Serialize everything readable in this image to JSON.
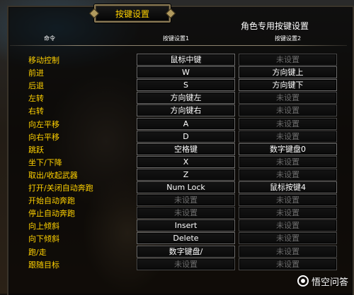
{
  "dialog": {
    "title": "按键设置",
    "character_specific_label": "角色专用按键设置",
    "columns": {
      "command": "命令",
      "key1": "按键设置1",
      "key2": "按键设置2"
    }
  },
  "bindings": [
    {
      "command": "移动控制",
      "key1": "鼠标中键",
      "key2": "未设置",
      "key1_set": true,
      "key2_set": false
    },
    {
      "command": "前进",
      "key1": "W",
      "key2": "方向键上",
      "key1_set": true,
      "key2_set": true
    },
    {
      "command": "后退",
      "key1": "S",
      "key2": "方向键下",
      "key1_set": true,
      "key2_set": true
    },
    {
      "command": "左转",
      "key1": "方向键左",
      "key2": "未设置",
      "key1_set": true,
      "key2_set": false
    },
    {
      "command": "右转",
      "key1": "方向键右",
      "key2": "未设置",
      "key1_set": true,
      "key2_set": false
    },
    {
      "command": "向左平移",
      "key1": "A",
      "key2": "未设置",
      "key1_set": true,
      "key2_set": false
    },
    {
      "command": "向右平移",
      "key1": "D",
      "key2": "未设置",
      "key1_set": true,
      "key2_set": false
    },
    {
      "command": "跳跃",
      "key1": "空格键",
      "key2": "数字键盘0",
      "key1_set": true,
      "key2_set": true
    },
    {
      "command": "坐下/下降",
      "key1": "X",
      "key2": "未设置",
      "key1_set": true,
      "key2_set": false
    },
    {
      "command": "取出/收起武器",
      "key1": "Z",
      "key2": "未设置",
      "key1_set": true,
      "key2_set": false
    },
    {
      "command": "打开/关闭自动奔跑",
      "key1": "Num Lock",
      "key2": "鼠标按键4",
      "key1_set": true,
      "key2_set": true
    },
    {
      "command": "开始自动奔跑",
      "key1": "未设置",
      "key2": "未设置",
      "key1_set": false,
      "key2_set": false
    },
    {
      "command": "停止自动奔跑",
      "key1": "未设置",
      "key2": "未设置",
      "key1_set": false,
      "key2_set": false
    },
    {
      "command": "向上倾斜",
      "key1": "Insert",
      "key2": "未设置",
      "key1_set": true,
      "key2_set": false
    },
    {
      "command": "向下倾斜",
      "key1": "Delete",
      "key2": "未设置",
      "key1_set": true,
      "key2_set": false
    },
    {
      "command": "跑/走",
      "key1": "数字键盘/",
      "key2": "未设置",
      "key1_set": true,
      "key2_set": false
    },
    {
      "command": "跟随目标",
      "key1": "未设置",
      "key2": "未设置",
      "key1_set": false,
      "key2_set": false
    }
  ],
  "colors": {
    "command_text": "#ffd100",
    "set_key_text": "#ffffff",
    "unset_key_text": "#6c6c6c"
  },
  "watermark": {
    "text": "悟空问答",
    "icon": "wukong-logo-icon"
  }
}
